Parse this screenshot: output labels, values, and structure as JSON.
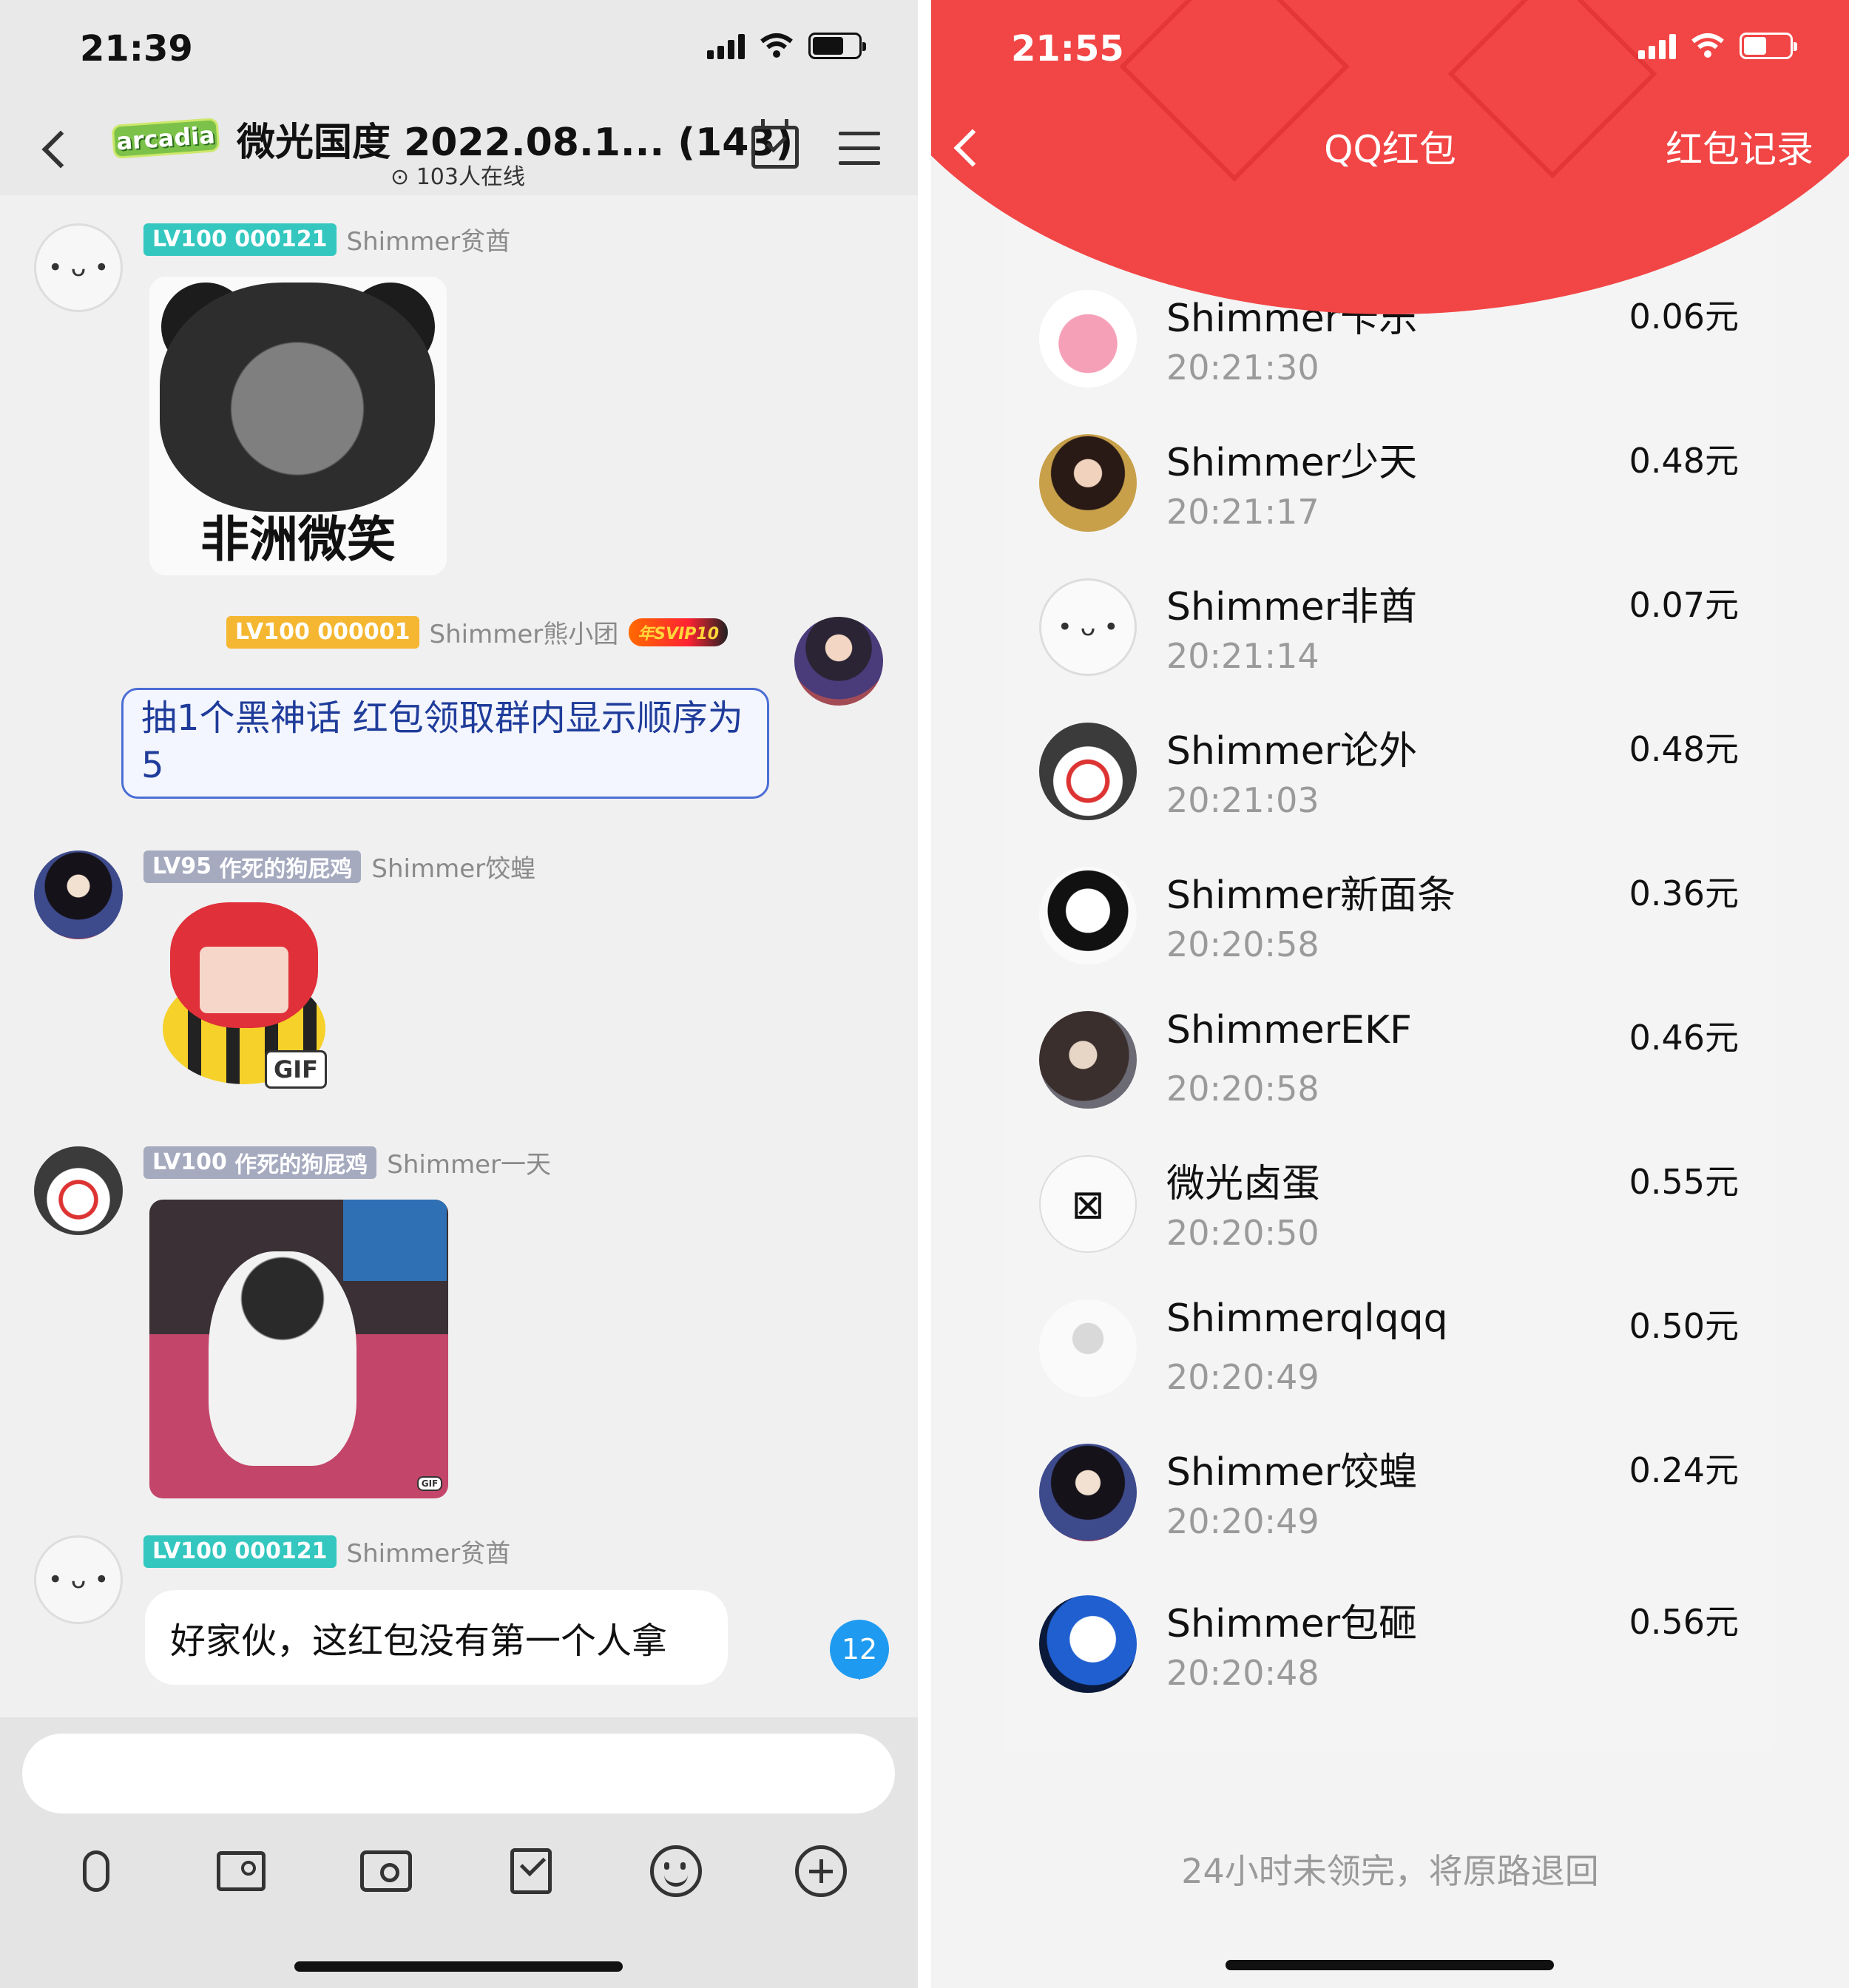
{
  "left": {
    "status": {
      "time": "21:39"
    },
    "nav": {
      "logo_text": "arcadia",
      "group_title": "微光国度 2022.08.1... (143)",
      "online": "103人在线"
    },
    "messages": [
      {
        "level": "LV100",
        "level_title": "000121",
        "sender": "Shimmer贫酋",
        "sticker_caption": "非洲微笑"
      },
      {
        "level": "LV100",
        "level_title": "000001",
        "sender": "Shimmer熊小团",
        "badge": "年SVIP10",
        "text": "抽1个黑神话 红包领取群内显示顺序为5"
      },
      {
        "level": "LV95",
        "level_title": "作死的狗屁鸡",
        "sender": "Shimmer饺蝗",
        "gif_label": "GIF"
      },
      {
        "level": "LV100",
        "level_title": "作死的狗屁鸡",
        "sender": "Shimmer一天",
        "gif_label": "GIF"
      },
      {
        "level": "LV100",
        "level_title": "000121",
        "sender": "Shimmer贫酋",
        "text": "好家伙，这红包没有第一个人拿"
      }
    ],
    "unread_count": "12",
    "input": {
      "placeholder": ""
    },
    "toolbar_icons": [
      "mic-icon",
      "image-icon",
      "camera-icon",
      "red-packet-icon",
      "emoji-icon",
      "plus-icon"
    ]
  },
  "right": {
    "status": {
      "time": "21:55"
    },
    "nav": {
      "title": "QQ红包",
      "record": "红包记录"
    },
    "claims": [
      {
        "name": "Shimmer卡乐",
        "time": "20:21:30",
        "amount": "0.06元"
      },
      {
        "name": "Shimmer少天",
        "time": "20:21:17",
        "amount": "0.48元"
      },
      {
        "name": "Shimmer非酋",
        "time": "20:21:14",
        "amount": "0.07元"
      },
      {
        "name": "Shimmer论外",
        "time": "20:21:03",
        "amount": "0.48元"
      },
      {
        "name": "Shimmer新面条",
        "time": "20:20:58",
        "amount": "0.36元"
      },
      {
        "name": "ShimmerEKF",
        "time": "20:20:58",
        "amount": "0.46元"
      },
      {
        "name": "微光卤蛋",
        "time": "20:20:50",
        "amount": "0.55元"
      },
      {
        "name": "Shimmerqlqqq",
        "time": "20:20:49",
        "amount": "0.50元"
      },
      {
        "name": "Shimmer饺蝗",
        "time": "20:20:49",
        "amount": "0.24元"
      },
      {
        "name": "Shimmer包砸",
        "time": "20:20:48",
        "amount": "0.56元"
      }
    ],
    "footer_note": "24小时未领完，将原路退回"
  },
  "colors": {
    "red_header": "#f24545",
    "level_teal": "#34c7c0",
    "level_gold": "#f5b731",
    "level_gray": "#a5aabf",
    "unread_blue": "#1e9bf0"
  }
}
